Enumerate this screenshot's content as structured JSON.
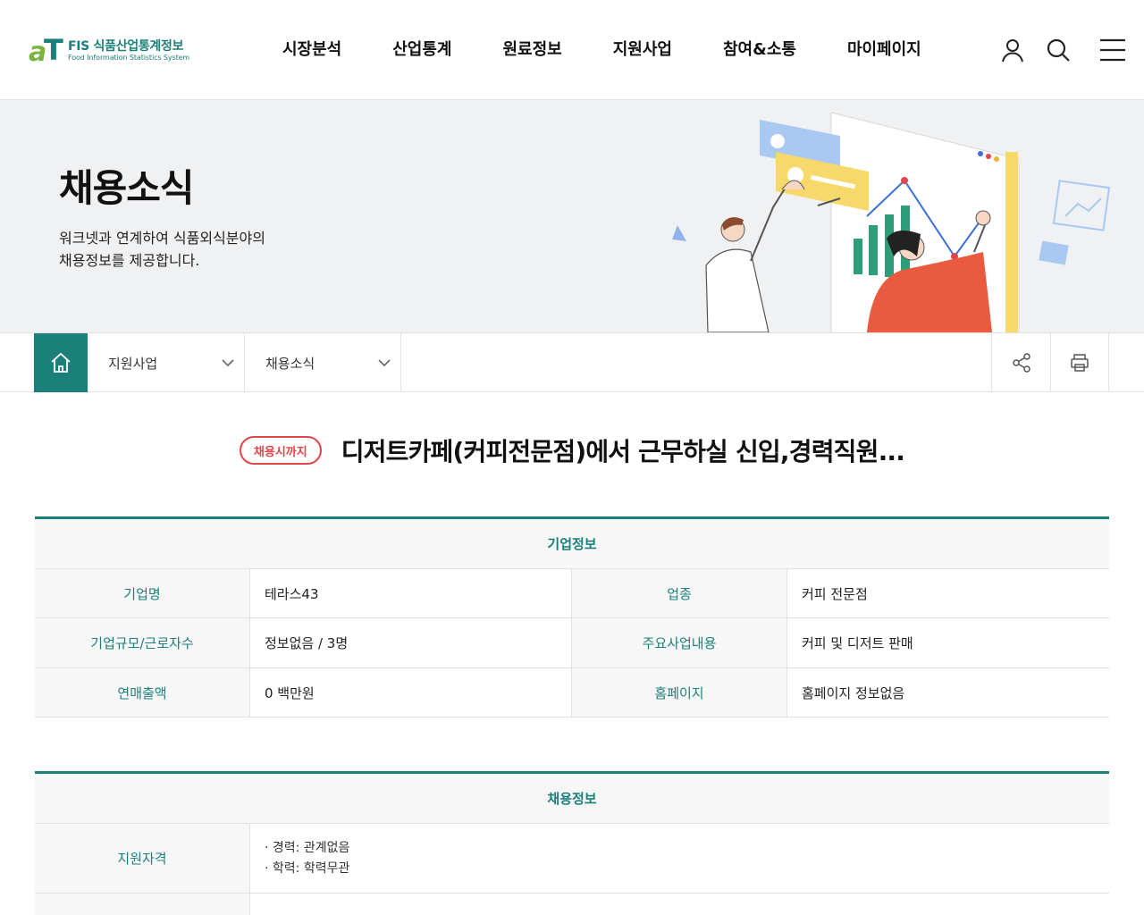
{
  "header": {
    "logo": {
      "title": "FIS 식품산업통계정보",
      "subtitle": "Food Information Statistics System"
    },
    "nav": [
      {
        "label": "시장분석"
      },
      {
        "label": "산업통계"
      },
      {
        "label": "원료정보"
      },
      {
        "label": "지원사업"
      },
      {
        "label": "참여&소통"
      },
      {
        "label": "마이페이지"
      }
    ],
    "icons": {
      "user": "user-icon",
      "search": "search-icon",
      "menu": "menu-icon"
    }
  },
  "visual": {
    "title": "채용소식",
    "desc_line1": "워크넷과 연계하여 식품외식분야의",
    "desc_line2": "채용정보를 제공합니다."
  },
  "location": {
    "depth1": "지원사업",
    "depth2": "채용소식",
    "icons": {
      "home": "home-icon",
      "share": "share-icon",
      "print": "print-icon"
    }
  },
  "post": {
    "badge": "채용시까지",
    "title": "디저트카페(커피전문점)에서 근무하실 신입,경력직원..."
  },
  "company": {
    "caption": "기업정보",
    "rows": [
      {
        "k1": "기업명",
        "v1": "테라스43",
        "k2": "업종",
        "v2": "커피 전문점"
      },
      {
        "k1": "기업규모/근로자수",
        "v1": "정보없음 / 3명",
        "k2": "주요사업내용",
        "v2": "커피 및 디저트 판매"
      },
      {
        "k1": "연매출액",
        "v1": "0 백만원",
        "k2": "홈페이지",
        "v2": "홈페이지 정보없음"
      }
    ]
  },
  "recruit": {
    "caption": "채용정보",
    "qualification_label": "지원자격",
    "qualification_lines": [
      "· 경력: 관계없음",
      "· 학력: 학력무관"
    ]
  },
  "colors": {
    "brand": "#1b7f7a",
    "badge": "#e0464a",
    "logo_a": "#7cb342"
  }
}
